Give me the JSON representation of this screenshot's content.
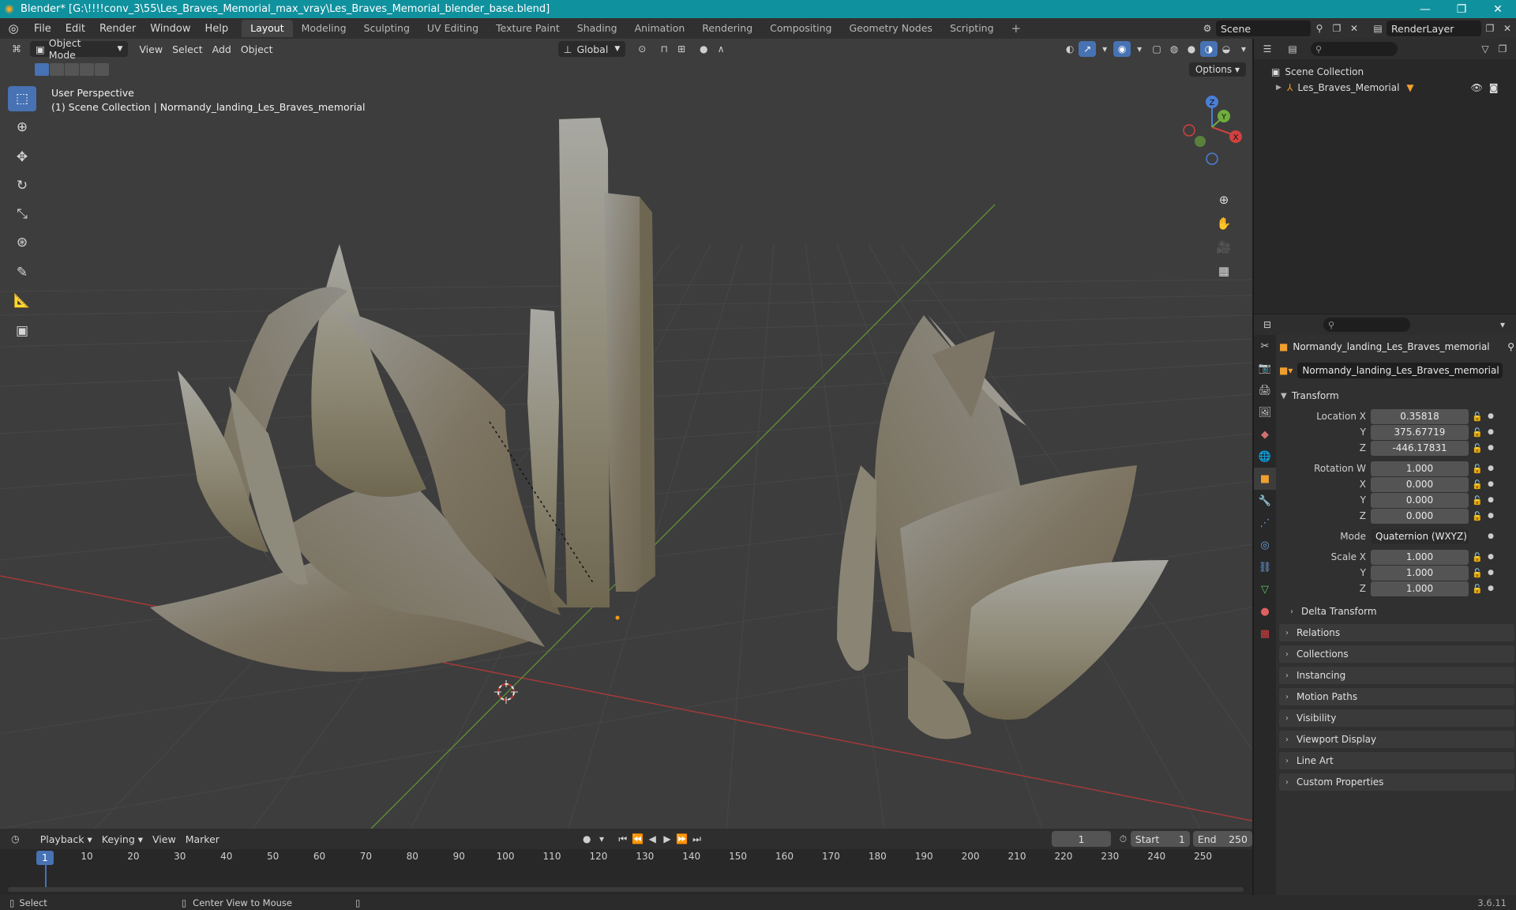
{
  "window": {
    "title": "Blender* [G:\\!!!!conv_3\\55\\Les_Braves_Memorial_max_vray\\Les_Braves_Memorial_blender_base.blend]",
    "minimize": "—",
    "maximize": "❐",
    "close": "✕"
  },
  "menubar": {
    "items": [
      "File",
      "Edit",
      "Render",
      "Window",
      "Help"
    ],
    "workspaces": [
      "Layout",
      "Modeling",
      "Sculpting",
      "UV Editing",
      "Texture Paint",
      "Shading",
      "Animation",
      "Rendering",
      "Compositing",
      "Geometry Nodes",
      "Scripting"
    ],
    "active_workspace": "Layout",
    "plus": "+",
    "scene": "Scene",
    "view_layer": "RenderLayer"
  },
  "viewport": {
    "mode": "Object Mode",
    "menus": [
      "View",
      "Select",
      "Add",
      "Object"
    ],
    "transform_orientation": "Global",
    "options": "Options",
    "info_line1": "User Perspective",
    "info_line2": "(1) Scene Collection | Normandy_landing_Les_Braves_memorial",
    "gizmo": {
      "x": "X",
      "y": "Y",
      "z": "Z"
    }
  },
  "outliner": {
    "root": "Scene Collection",
    "items": [
      {
        "label": "Les_Braves_Memorial"
      }
    ]
  },
  "properties": {
    "object_name": "Normandy_landing_Les_Braves_memorial",
    "data_name": "Normandy_landing_Les_Braves_memorial",
    "transform_title": "Transform",
    "location": {
      "label": "Location X",
      "x": "0.35818",
      "y": "375.67719",
      "z": "-446.17831"
    },
    "rotation": {
      "label": "Rotation W",
      "w": "1.000",
      "x": "0.000",
      "y": "0.000",
      "z": "0.000"
    },
    "axis_labels": {
      "x": "X",
      "y": "Y",
      "z": "Z"
    },
    "mode_label": "Mode",
    "mode_value": "Quaternion (WXYZ)",
    "scale": {
      "label": "Scale X",
      "x": "1.000",
      "y": "1.000",
      "z": "1.000"
    },
    "delta_transform": "Delta Transform",
    "sections": [
      "Relations",
      "Collections",
      "Instancing",
      "Motion Paths",
      "Visibility",
      "Viewport Display",
      "Line Art",
      "Custom Properties"
    ]
  },
  "timeline": {
    "menus": [
      "Playback",
      "Keying",
      "View",
      "Marker"
    ],
    "current_frame": "1",
    "start_label": "Start",
    "start": "1",
    "end_label": "End",
    "end": "250",
    "ticks": [
      "10",
      "20",
      "30",
      "40",
      "50",
      "60",
      "70",
      "80",
      "90",
      "100",
      "110",
      "120",
      "130",
      "140",
      "150",
      "160",
      "170",
      "180",
      "190",
      "200",
      "210",
      "220",
      "230",
      "240",
      "250"
    ]
  },
  "statusbar": {
    "select": "Select",
    "center_view": "Center View to Mouse",
    "version": "3.6.11"
  },
  "colors": {
    "titlebar": "#10919e",
    "accent": "#4772b3",
    "x_axis": "#c0392b",
    "y_axis": "#6aa13a"
  }
}
